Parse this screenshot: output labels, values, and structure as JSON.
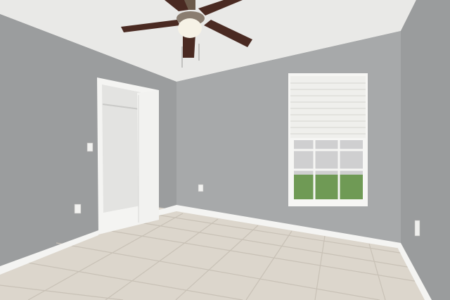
{
  "scene": {
    "description_free": true,
    "colors": {
      "ceiling": "#e9e9e7",
      "wall_left": "#9b9d9e",
      "wall_back": "#a7a9aa",
      "wall_right": "#9a9c9d",
      "baseboard": "#f4f4f2",
      "floor": "#dcd6cc",
      "grout": "#c8c1b6",
      "door": "#f2f2f0",
      "closet": "#e3e3e1",
      "window_frame": "#f6f6f4",
      "blinds": "#efefec",
      "glass": "#cfcfd0",
      "greenery": "#6f9a55",
      "fan_blade": "#4a2a22",
      "fan_light": "#f6f2e6"
    }
  }
}
